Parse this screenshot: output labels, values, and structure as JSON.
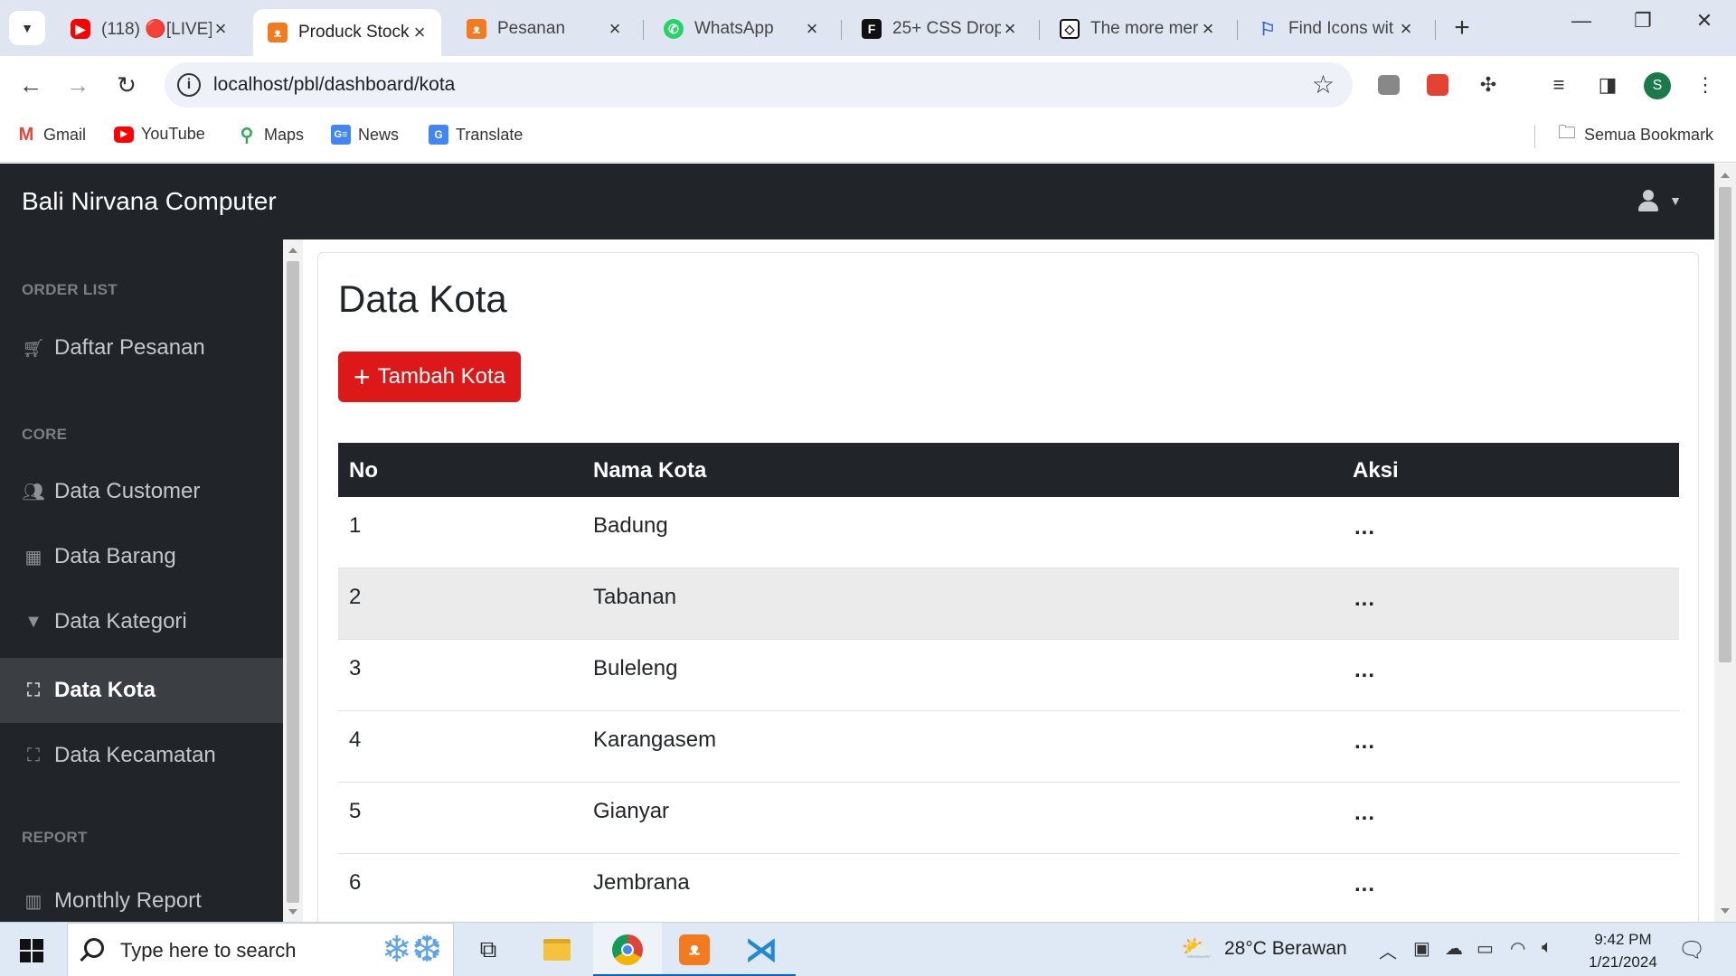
{
  "browser": {
    "tabs": [
      {
        "title": "(118) 🔴[LIVE]",
        "favicon": "youtube-icon",
        "active": false
      },
      {
        "title": "Produck Stock",
        "favicon": "xampp-icon",
        "active": true
      },
      {
        "title": "Pesanan",
        "favicon": "xampp-icon",
        "active": false
      },
      {
        "title": "WhatsApp",
        "favicon": "whatsapp-icon",
        "active": false
      },
      {
        "title": "25+ CSS Drop",
        "favicon": "freefrontend-icon",
        "active": false
      },
      {
        "title": "The more mer",
        "favicon": "codepen-icon",
        "active": false
      },
      {
        "title": "Find Icons wit",
        "favicon": "flag-icon",
        "active": false
      }
    ],
    "url": "localhost/pbl/dashboard/kota",
    "bookmarks": [
      {
        "label": "Gmail",
        "icon": "gmail-icon"
      },
      {
        "label": "YouTube",
        "icon": "youtube-icon"
      },
      {
        "label": "Maps",
        "icon": "maps-icon"
      },
      {
        "label": "News",
        "icon": "news-icon"
      },
      {
        "label": "Translate",
        "icon": "translate-icon"
      }
    ],
    "all_bookmarks_label": "Semua Bookmark",
    "profile_initial": "S"
  },
  "app": {
    "brand": "Bali Nirvana Computer",
    "sidebar": {
      "sections": [
        {
          "heading": "ORDER LIST",
          "items": [
            {
              "label": "Daftar Pesanan",
              "icon": "cart-icon"
            }
          ]
        },
        {
          "heading": "CORE",
          "items": [
            {
              "label": "Data Customer",
              "icon": "users-icon"
            },
            {
              "label": "Data Barang",
              "icon": "boxes-icon"
            },
            {
              "label": "Data Kategori",
              "icon": "filter-icon"
            },
            {
              "label": "Data Kota",
              "icon": "map-location-icon",
              "active": true
            },
            {
              "label": "Data Kecamatan",
              "icon": "map-location-icon"
            }
          ]
        },
        {
          "heading": "REPORT",
          "items": [
            {
              "label": "Monthly Report",
              "icon": "chart-icon"
            }
          ]
        }
      ]
    },
    "page": {
      "title": "Data Kota",
      "add_button": "Tambah Kota",
      "table": {
        "headers": [
          "No",
          "Nama Kota",
          "Aksi"
        ],
        "rows": [
          {
            "no": "1",
            "nama": "Badung",
            "aksi": "..."
          },
          {
            "no": "2",
            "nama": "Tabanan",
            "aksi": "..."
          },
          {
            "no": "3",
            "nama": "Buleleng",
            "aksi": "..."
          },
          {
            "no": "4",
            "nama": "Karangasem",
            "aksi": "..."
          },
          {
            "no": "5",
            "nama": "Gianyar",
            "aksi": "..."
          },
          {
            "no": "6",
            "nama": "Jembrana",
            "aksi": "..."
          }
        ]
      }
    }
  },
  "taskbar": {
    "search_placeholder": "Type here to search",
    "weather": "28°C  Berawan",
    "time": "9:42 PM",
    "date": "1/21/2024"
  },
  "colors": {
    "dark": "#212529",
    "accent_red": "#dc1818",
    "active_sidebar": "#3b3f44"
  }
}
